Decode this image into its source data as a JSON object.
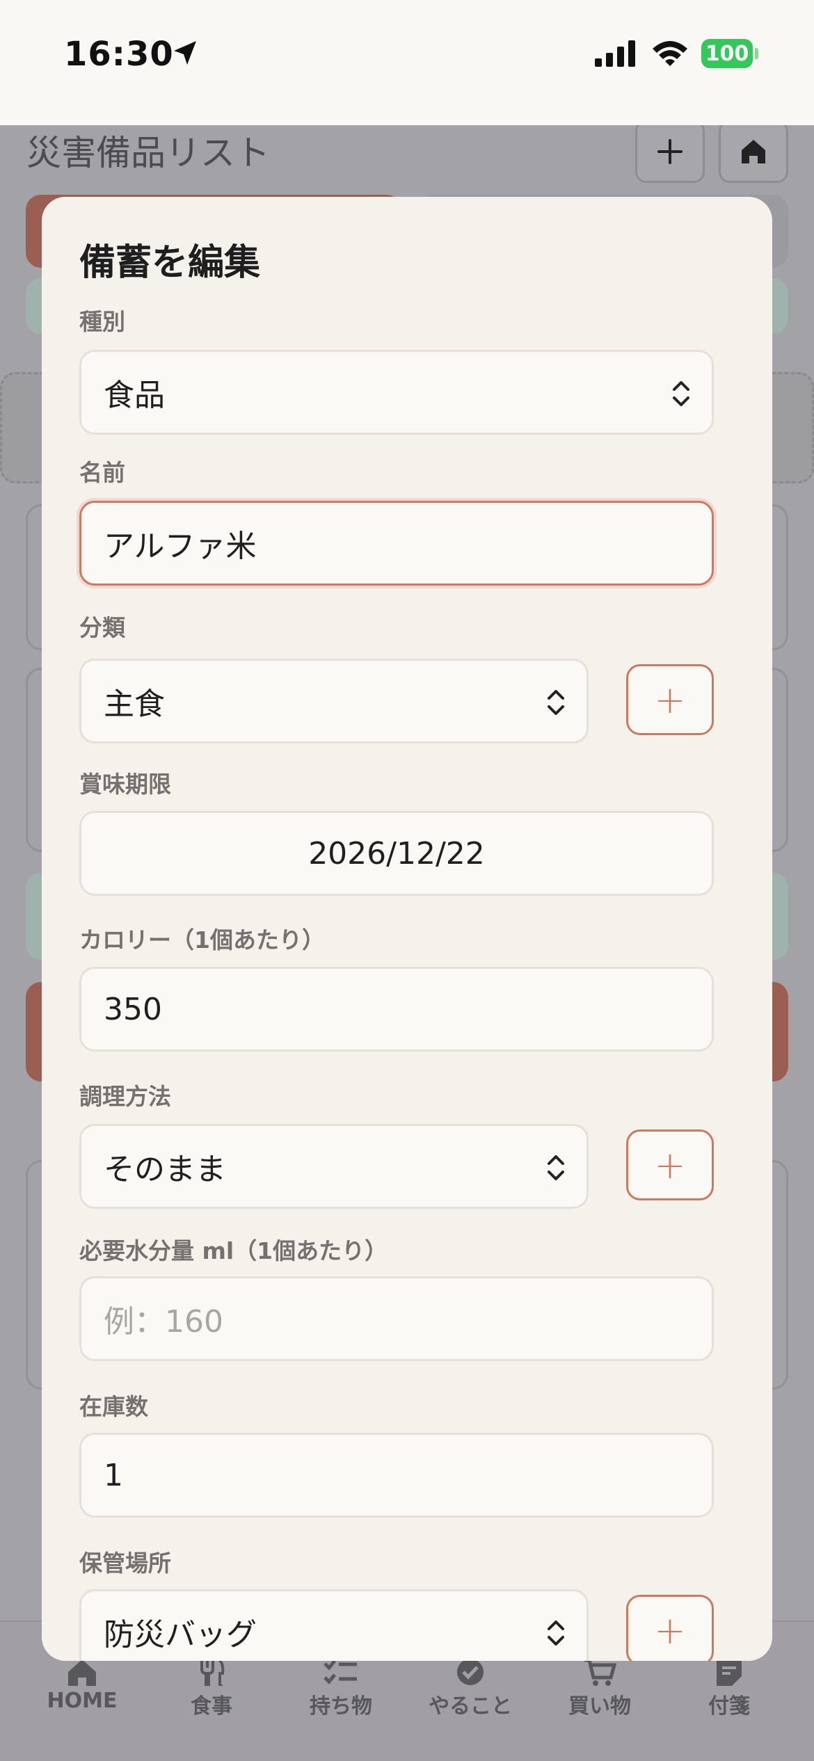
{
  "status_bar": {
    "time": "16:30",
    "battery": "100",
    "battery_color": "#34c759"
  },
  "page": {
    "title": "災害備品リスト"
  },
  "bottom_nav": {
    "items": [
      {
        "label": "HOME",
        "icon": "home-icon"
      },
      {
        "label": "食事",
        "icon": "fork-knife-icon"
      },
      {
        "label": "持ち物",
        "icon": "checklist-icon"
      },
      {
        "label": "やること",
        "icon": "check-circle-icon"
      },
      {
        "label": "買い物",
        "icon": "cart-icon"
      },
      {
        "label": "付箋",
        "icon": "sticky-note-icon"
      }
    ]
  },
  "modal": {
    "title": "備蓄を編集",
    "type_label": "種別",
    "type_value": "食品",
    "name_label": "名前",
    "name_value": "アルファ米",
    "category_label": "分類",
    "category_value": "主食",
    "expiry_label": "賞味期限",
    "expiry_value": "2026/12/22",
    "calorie_label": "カロリー（1個あたり）",
    "calorie_value": "350",
    "cooking_label": "調理方法",
    "cooking_value": "そのまま",
    "water_label": "必要水分量 ml（1個あたり）",
    "water_placeholder": "例：160",
    "stock_label": "在庫数",
    "stock_value": "1",
    "location_label": "保管場所",
    "location_value": "防災バッグ",
    "add_symbol": "+"
  },
  "colors": {
    "accent": "#cc7a5f",
    "modal_bg": "#f5f1eb",
    "field_bg": "#fbf9f6",
    "label": "#767170"
  }
}
